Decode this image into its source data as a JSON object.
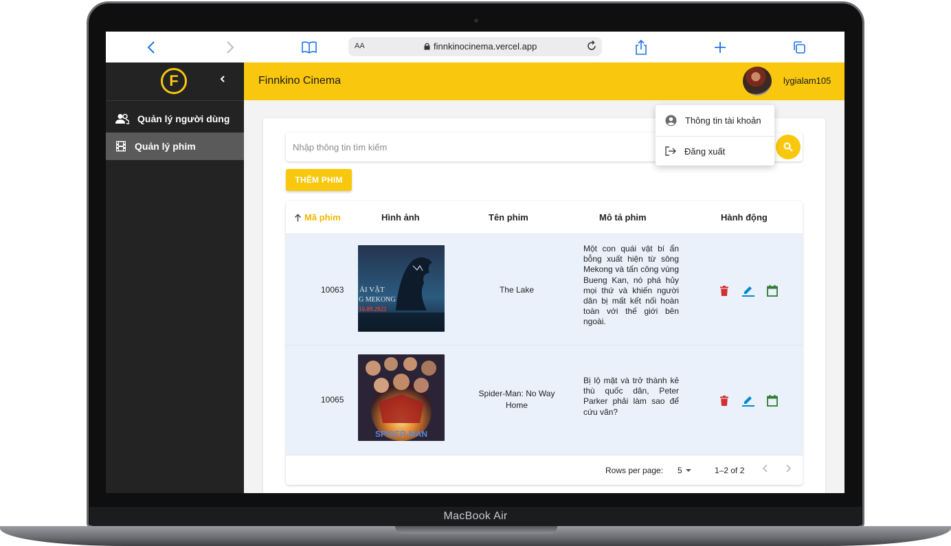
{
  "device": {
    "label": "MacBook Air"
  },
  "browser": {
    "text_size_label": "AA",
    "url": "finnkinocinema.vercel.app"
  },
  "sidebar": {
    "logo_letter": "F",
    "items": [
      {
        "label": "Quản lý người dùng",
        "icon": "users-icon"
      },
      {
        "label": "Quản lý phim",
        "icon": "film-icon",
        "active": true
      }
    ]
  },
  "header": {
    "title": "Finnkino Cinema",
    "username": "lygialam105"
  },
  "account_menu": {
    "items": [
      {
        "label": "Thông tin tài khoản",
        "icon": "account-circle-icon"
      },
      {
        "label": "Đăng xuất",
        "icon": "logout-icon"
      }
    ]
  },
  "search": {
    "placeholder": "Nhập thông tin tìm kiếm",
    "value": ""
  },
  "add_button": {
    "label": "THÊM PHIM"
  },
  "table": {
    "columns": [
      "Mã phim",
      "Hình ảnh",
      "Tên phim",
      "Mô tả phim",
      "Hành động"
    ],
    "sorted_column": "Mã phim",
    "sort_direction": "ascending",
    "rows": [
      {
        "id": "10063",
        "poster_text": [
          "ÁI VẬT",
          "G MEKONG",
          "16.09.2022"
        ],
        "name": "The Lake",
        "description": "Một con quái vật bí ẩn bỗng xuất hiện từ sông Mekong và tấn công vùng Bueng Kan, nó phá hủy mọi thứ và khiến người dân bị mất kết nối hoàn toàn với thế giới bên ngoài."
      },
      {
        "id": "10065",
        "poster_text": [
          "SPIDER-MAN"
        ],
        "name": "Spider-Man: No Way Home",
        "description": "Bị lộ mặt và trở thành kẻ thù quốc dân, Peter Parker phải làm sao để cứu vãn?"
      }
    ],
    "actions": [
      "delete-icon",
      "edit-icon",
      "calendar-icon"
    ],
    "colors": {
      "delete": "#d32f2f",
      "edit": "#0288d1",
      "calendar": "#2e7d32"
    }
  },
  "pagination": {
    "rows_per_page_label": "Rows per page:",
    "rows_per_page": "5",
    "range": "1–2 of 2"
  },
  "colors": {
    "accent": "#f9c80e",
    "sidebar": "#232323",
    "row_bg": "#eaf1fb"
  }
}
